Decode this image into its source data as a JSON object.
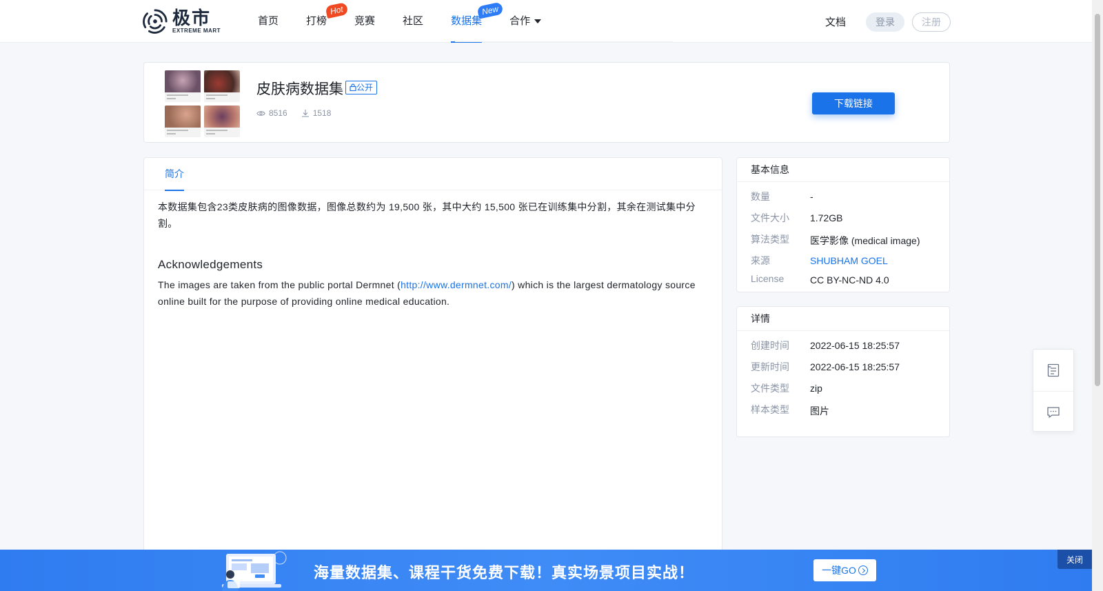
{
  "brand": {
    "name_cn": "极市",
    "name_en": "EXTREME MART"
  },
  "nav": {
    "items": [
      {
        "label": "首页"
      },
      {
        "label": "打榜",
        "badge": "Hot"
      },
      {
        "label": "竞赛"
      },
      {
        "label": "社区"
      },
      {
        "label": "数据集",
        "badge": "New",
        "active": true
      },
      {
        "label": "合作"
      }
    ],
    "docs": "文档",
    "login": "登录",
    "register": "注册"
  },
  "dataset": {
    "title": "皮肤病数据集",
    "visibility": "公开",
    "views": "8516",
    "downloads": "1518",
    "download_button": "下载链接"
  },
  "content": {
    "tab": "简介",
    "intro": "本数据集包含23类皮肤病的图像数据，图像总数约为 19,500 张，其中大约 15,500 张已在训练集中分割，其余在测试集中分割。",
    "ack_title": "Acknowledgements",
    "ack_before": "The images are taken from the public portal Dermnet (",
    "ack_link": "http://www.dermnet.com/",
    "ack_after": ") which is the largest dermatology source online built for the purpose of providing online medical education."
  },
  "basic_info": {
    "title": "基本信息",
    "rows": [
      {
        "key": "数量",
        "value": "-"
      },
      {
        "key": "文件大小",
        "value": "1.72GB"
      },
      {
        "key": "算法类型",
        "value": "医学影像 (medical image)"
      },
      {
        "key": "来源",
        "value": "SHUBHAM GOEL"
      },
      {
        "key": "License",
        "value": "CC BY-NC-ND 4.0"
      }
    ]
  },
  "details": {
    "title": "详情",
    "rows": [
      {
        "key": "创建时间",
        "value": "2022-06-15 18:25:57"
      },
      {
        "key": "更新时间",
        "value": "2022-06-15 18:25:57"
      },
      {
        "key": "文件类型",
        "value": "zip"
      },
      {
        "key": "样本类型",
        "value": "图片"
      }
    ]
  },
  "banner": {
    "text": "海量数据集、课程干货免费下载！真实场景项目实战！",
    "go_button": "一键GO",
    "close_button": "关闭"
  },
  "colors": {
    "accent": "#1a73e8",
    "hot": "#f04a23",
    "new": "#2b7cf6",
    "banner": "#3f8cf7"
  },
  "icons": [
    "logo-icon",
    "caret-down-icon",
    "lock-icon",
    "eye-icon",
    "download-icon",
    "document-icon",
    "chat-icon",
    "arrow-circle-icon"
  ]
}
